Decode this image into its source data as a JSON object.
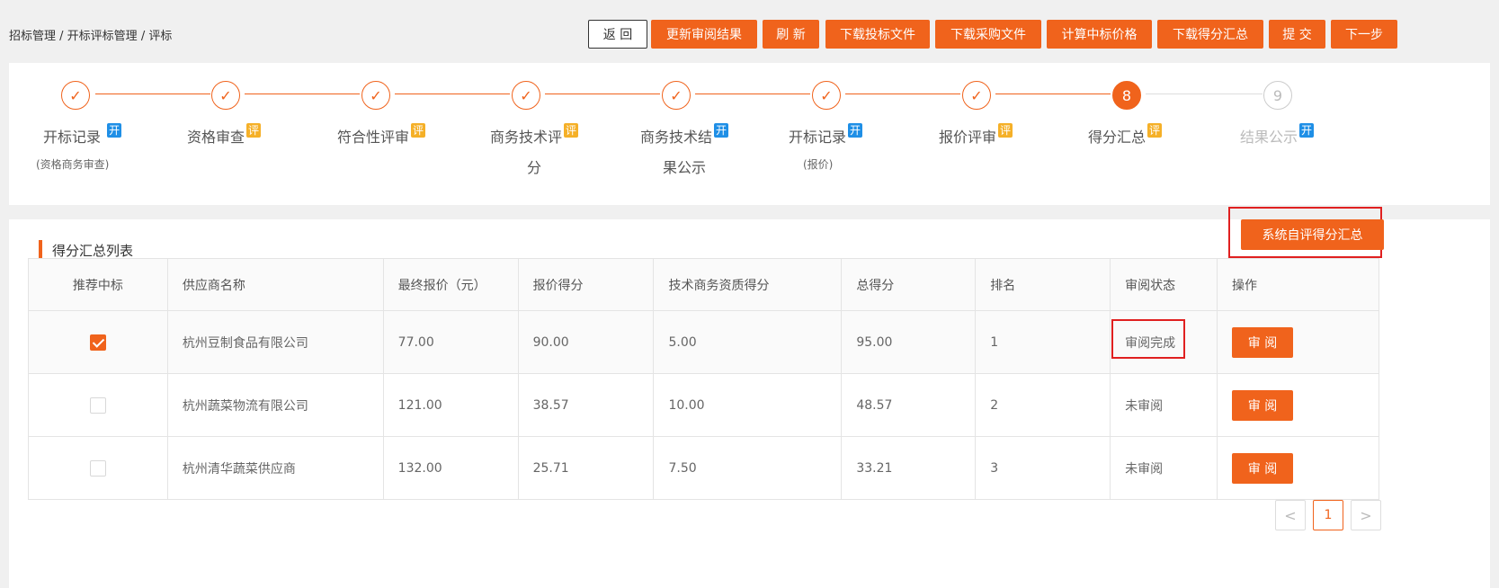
{
  "breadcrumb": {
    "items": [
      "招标管理",
      "开标评标管理",
      "评标"
    ],
    "separator": " / "
  },
  "toolbar": {
    "back": "返 回",
    "update_review": "更新审阅结果",
    "refresh": "刷 新",
    "download_bid": "下载投标文件",
    "download_procurement": "下载采购文件",
    "calc_price": "计算中标价格",
    "download_summary": "下载得分汇总",
    "submit": "提 交",
    "next": "下一步"
  },
  "steps": [
    {
      "label": "开标记录",
      "tag": "开",
      "tag_color": "#1f8fe6",
      "sub": "(资格商务审查)",
      "status": "done"
    },
    {
      "label": "资格审查",
      "tag": "评",
      "tag_color": "#f5b028",
      "status": "done"
    },
    {
      "label": "符合性评审",
      "tag": "评",
      "tag_color": "#f5b028",
      "status": "done"
    },
    {
      "label": "商务技术评",
      "label2": "分",
      "tag": "评",
      "tag_color": "#f5b028",
      "status": "done"
    },
    {
      "label": "商务技术结",
      "label2": "果公示",
      "tag": "开",
      "tag_color": "#1f8fe6",
      "status": "done"
    },
    {
      "label": "开标记录",
      "tag": "开",
      "tag_color": "#1f8fe6",
      "sub": "(报价)",
      "status": "done"
    },
    {
      "label": "报价评审",
      "tag": "评",
      "tag_color": "#f5b028",
      "status": "done"
    },
    {
      "label": "得分汇总",
      "tag": "评",
      "tag_color": "#f5b028",
      "number": "8",
      "status": "active"
    },
    {
      "label": "结果公示",
      "tag": "开",
      "tag_color": "#1f8fe6",
      "number": "9",
      "status": "pending"
    }
  ],
  "section": {
    "title": "得分汇总列表",
    "sys_button": "系统自评得分汇总"
  },
  "table": {
    "headers": [
      "推荐中标",
      "供应商名称",
      "最终报价（元）",
      "报价得分",
      "技术商务资质得分",
      "总得分",
      "排名",
      "审阅状态",
      "操作"
    ],
    "rows": [
      {
        "recommended": true,
        "supplier": "杭州豆制食品有限公司",
        "final_price": "77.00",
        "price_score": "90.00",
        "tech_score": "5.00",
        "total": "95.00",
        "rank": "1",
        "status": "审阅完成",
        "action": "审 阅"
      },
      {
        "recommended": false,
        "supplier": "杭州蔬菜物流有限公司",
        "final_price": "121.00",
        "price_score": "38.57",
        "tech_score": "10.00",
        "total": "48.57",
        "rank": "2",
        "status": "未审阅",
        "action": "审 阅"
      },
      {
        "recommended": false,
        "supplier": "杭州清华蔬菜供应商",
        "final_price": "132.00",
        "price_score": "25.71",
        "tech_score": "7.50",
        "total": "33.21",
        "rank": "3",
        "status": "未审阅",
        "action": "审 阅"
      }
    ]
  },
  "pagination": {
    "prev": "<",
    "current": "1",
    "next": ">"
  },
  "colors": {
    "accent": "#f0631c",
    "tag_blue": "#1f8fe6",
    "tag_yellow": "#f5b028",
    "highlight_red": "#e02020"
  }
}
